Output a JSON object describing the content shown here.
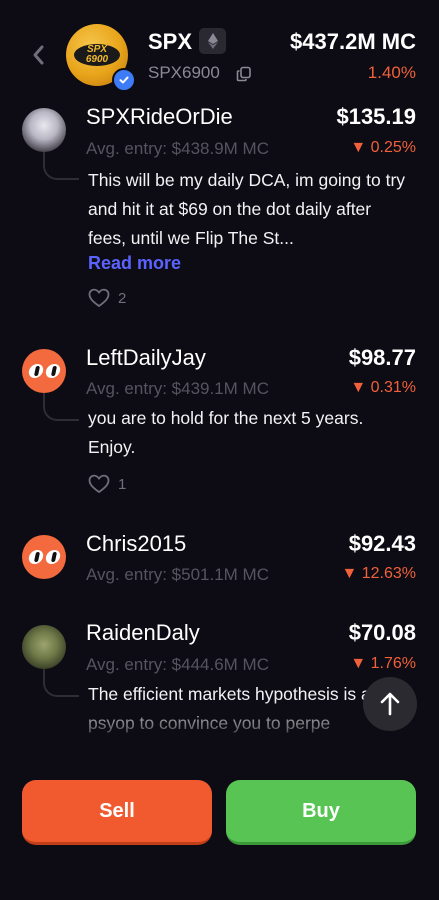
{
  "header": {
    "ticker": "SPX",
    "token_name": "SPX6900",
    "logo_text": "SPX\n6900",
    "market_cap": "$437.2M MC",
    "change": "1.40%"
  },
  "posts": [
    {
      "username": "SPXRideOrDie",
      "price": "$135.19",
      "avg_entry": "Avg. entry: $438.9M MC",
      "change": "0.25%",
      "text": "This will be my daily DCA, im going to try and hit it at $69 on the dot daily after fees, until we Flip The St...",
      "read_more": "Read more",
      "likes": "2"
    },
    {
      "username": "LeftDailyJay",
      "price": "$98.77",
      "avg_entry": "Avg. entry: $439.1M MC",
      "change": "0.31%",
      "text": "you are to hold for the next 5 years. Enjoy.",
      "likes": "1"
    },
    {
      "username": "Chris2015",
      "price": "$92.43",
      "avg_entry": "Avg. entry: $501.1M MC",
      "change": "12.63%"
    },
    {
      "username": "RaidenDaly",
      "price": "$70.08",
      "avg_entry": "Avg. entry: $444.6M MC",
      "change": "1.76%",
      "text": "The efficient markets hypothesis is a psyop to convince you to perpe"
    }
  ],
  "actions": {
    "sell_label": "Sell",
    "buy_label": "Buy"
  },
  "colors": {
    "background": "#0d0c14",
    "negative": "#f0603a",
    "link": "#5b63ff",
    "sell": "#f05a2e",
    "buy": "#58c454"
  }
}
